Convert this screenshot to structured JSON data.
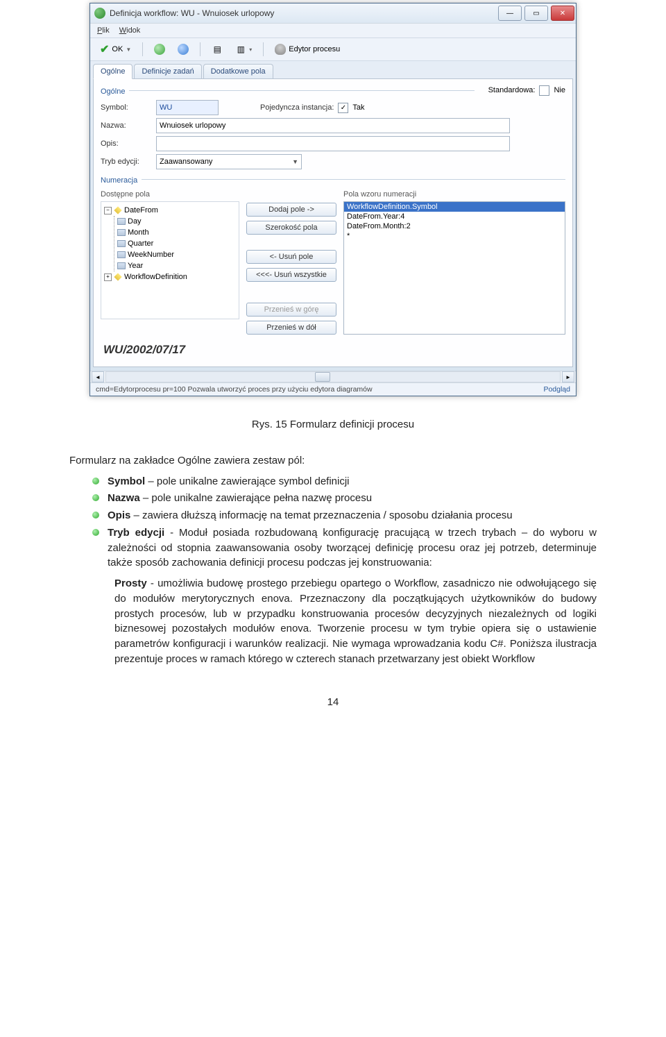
{
  "window": {
    "title": "Definicja workflow: WU - Wnuiosek urlopowy"
  },
  "menubar": {
    "file": "Plik",
    "view": "Widok"
  },
  "toolbar": {
    "ok": "OK",
    "editor": "Edytor procesu"
  },
  "tabs": {
    "general": "Ogólne",
    "tasks": "Definicje zadań",
    "extra": "Dodatkowe pola"
  },
  "form": {
    "group_general": "Ogólne",
    "standard_label": "Standardowa:",
    "standard_value": "Nie",
    "symbol_label": "Symbol:",
    "symbol_value": "WU",
    "single_label": "Pojedyncza instancja:",
    "single_value": "Tak",
    "name_label": "Nazwa:",
    "name_value": "Wnuiosek urlopowy",
    "desc_label": "Opis:",
    "desc_value": "",
    "mode_label": "Tryb edycji:",
    "mode_value": "Zaawansowany",
    "group_numer": "Numeracja",
    "avail_title": "Dostępne pola",
    "pattern_title": "Pola wzoru numeracji",
    "tree": {
      "root": "DateFrom",
      "children": [
        "Day",
        "Month",
        "Quarter",
        "WeekNumber",
        "Year"
      ],
      "sibling": "WorkflowDefinition"
    },
    "buttons": {
      "add": "Dodaj pole ->",
      "width": "Szerokość pola",
      "remove": "<- Usuń pole",
      "remove_all": "<<<- Usuń wszystkie",
      "move_up": "Przenieś w górę",
      "move_down": "Przenieś w dół"
    },
    "pattern_items": [
      "WorkflowDefinition.Symbol",
      "DateFrom.Year:4",
      "DateFrom.Month:2",
      "*"
    ],
    "preview": "WU/2002/07/17"
  },
  "statusbar": {
    "left": "cmd=Edytorprocesu pr=100 Pozwala utworzyć proces przy użyciu edytora diagramów",
    "right": "Podgląd"
  },
  "doc": {
    "caption": "Rys. 15 Formularz definicji procesu",
    "intro": "Formularz na zakładce Ogólne zawiera zestaw pól:",
    "bullets": [
      {
        "b": "Symbol",
        "t": " – pole unikalne zawierające symbol definicji"
      },
      {
        "b": "Nazwa",
        "t": " – pole unikalne zawierające pełna nazwę procesu"
      },
      {
        "b": "Opis",
        "t": " – zawiera dłuższą informację na temat przeznaczenia / sposobu działania procesu"
      },
      {
        "b": "Tryb edycji",
        "t": " - Moduł posiada rozbudowaną konfigurację pracującą w trzech trybach – do wyboru w zależności od stopnia zaawansowania osoby tworzącej definicję procesu oraz jej potrzeb, determinuje także sposób zachowania definicji procesu podczas jej konstruowania:"
      }
    ],
    "sub_b": "Prosty",
    "sub_t": " - umożliwia budowę prostego przebiegu opartego o Workflow, zasadniczo nie odwołującego się do modułów merytorycznych enova. Przeznaczony dla początkujących użytkowników do budowy prostych procesów, lub w przypadku konstruowania procesów decyzyjnych niezależnych od logiki biznesowej pozostałych modułów enova. Tworzenie procesu w tym trybie opiera się o ustawienie parametrów konfiguracji i warunków realizacji. Nie wymaga wprowadzania kodu C#. Poniższa ilustracja prezentuje proces w ramach którego w czterech stanach przetwarzany jest obiekt Workflow",
    "page": "14"
  }
}
